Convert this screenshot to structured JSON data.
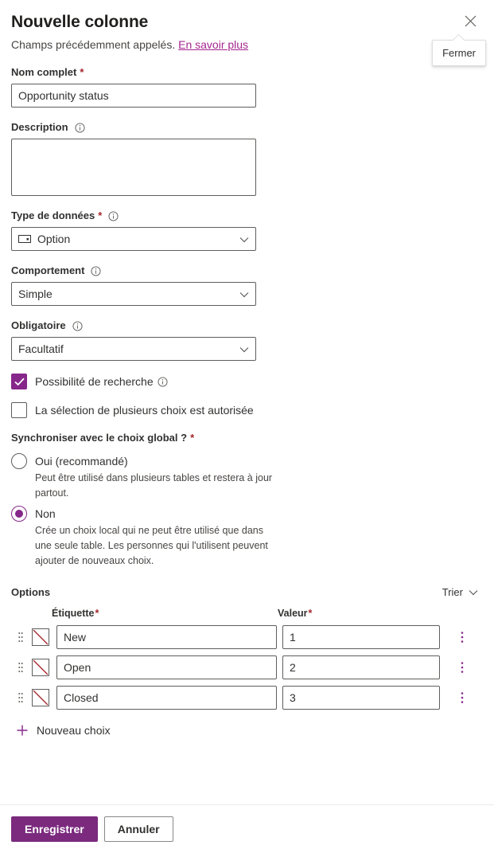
{
  "header": {
    "title": "Nouvelle colonne",
    "subtitle_text": "Champs précédemment appelés.",
    "subtitle_link": "En savoir plus",
    "close_icon": "close-icon",
    "close_tooltip": "Fermer"
  },
  "fields": {
    "display_name": {
      "label": "Nom complet",
      "required_mark": "*",
      "value": "Opportunity status",
      "placeholder": ""
    },
    "description": {
      "label": "Description",
      "value": "",
      "placeholder": ""
    },
    "data_type": {
      "label": "Type de données",
      "required_mark": "*",
      "value": "Option",
      "icon": "option-set-icon"
    },
    "behavior": {
      "label": "Comportement",
      "value": "Simple"
    },
    "required": {
      "label": "Obligatoire",
      "value": "Facultatif"
    }
  },
  "checkboxes": [
    {
      "label": "Possibilité de recherche",
      "checked": true,
      "has_info": true
    },
    {
      "label": "La sélection de plusieurs choix est autorisée",
      "checked": false,
      "has_info": false
    }
  ],
  "sync_group": {
    "label": "Synchroniser avec le choix global ?",
    "required_mark": "*",
    "options": [
      {
        "label": "Oui (recommandé)",
        "selected": false,
        "description": "Peut être utilisé dans plusieurs tables et restera à jour partout."
      },
      {
        "label": "Non",
        "selected": true,
        "description": "Crée un choix local qui ne peut être utilisé que dans une seule table. Les personnes qui l'utilisent peuvent ajouter de nouveaux choix."
      }
    ]
  },
  "options_section": {
    "title": "Options",
    "sort_label": "Trier",
    "columns": {
      "label": "Étiquette",
      "label_required": "*",
      "value": "Valeur",
      "value_required": "*"
    },
    "rows": [
      {
        "label": "New",
        "value": "1",
        "color": "none"
      },
      {
        "label": "Open",
        "value": "2",
        "color": "none"
      },
      {
        "label": "Closed",
        "value": "3",
        "color": "none"
      }
    ],
    "new_choice_label": "Nouveau choix"
  },
  "footer": {
    "save_label": "Enregistrer",
    "cancel_label": "Annuler"
  },
  "colors": {
    "accent": "#86278a",
    "primary_button": "#7b2a7e",
    "link": "#a4268f",
    "required_asterisk": "#a4262c",
    "no_color_slash": "#a4262c"
  }
}
